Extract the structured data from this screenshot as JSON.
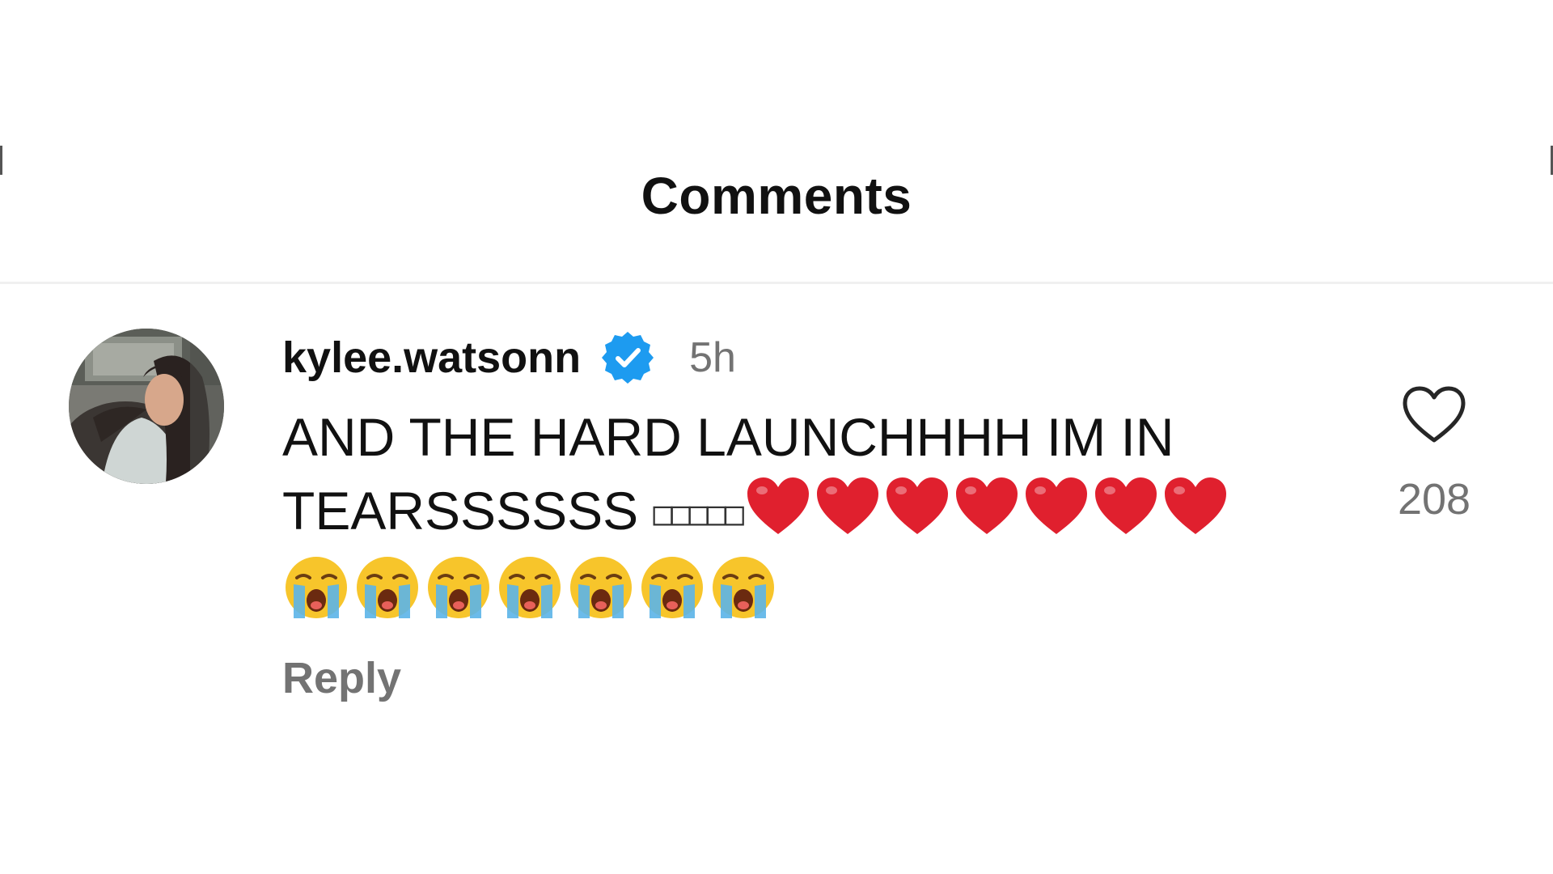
{
  "header": {
    "title": "Comments"
  },
  "comment": {
    "username": "kylee.watsonn",
    "verified": true,
    "timestamp": "5h",
    "text_line": "AND THE HARD LAUNCHHHH IM IN TEARSSSSSS",
    "unrendered_glyphs": "□□□□□",
    "heart_count": 7,
    "crying_face_count": 7,
    "reply_label": "Reply",
    "like_count": "208"
  },
  "icons": {
    "verified": "verified-badge-icon",
    "like": "heart-outline-icon",
    "heart_emoji": "red-heart-emoji",
    "crying_emoji": "loudly-crying-face-emoji"
  },
  "colors": {
    "primary_text": "#111111",
    "secondary_text": "#737373",
    "verified_blue": "#1d9bf0",
    "heart_red": "#e0202e",
    "emoji_yellow": "#f7c52b",
    "tears_blue": "#5bb4e8"
  }
}
